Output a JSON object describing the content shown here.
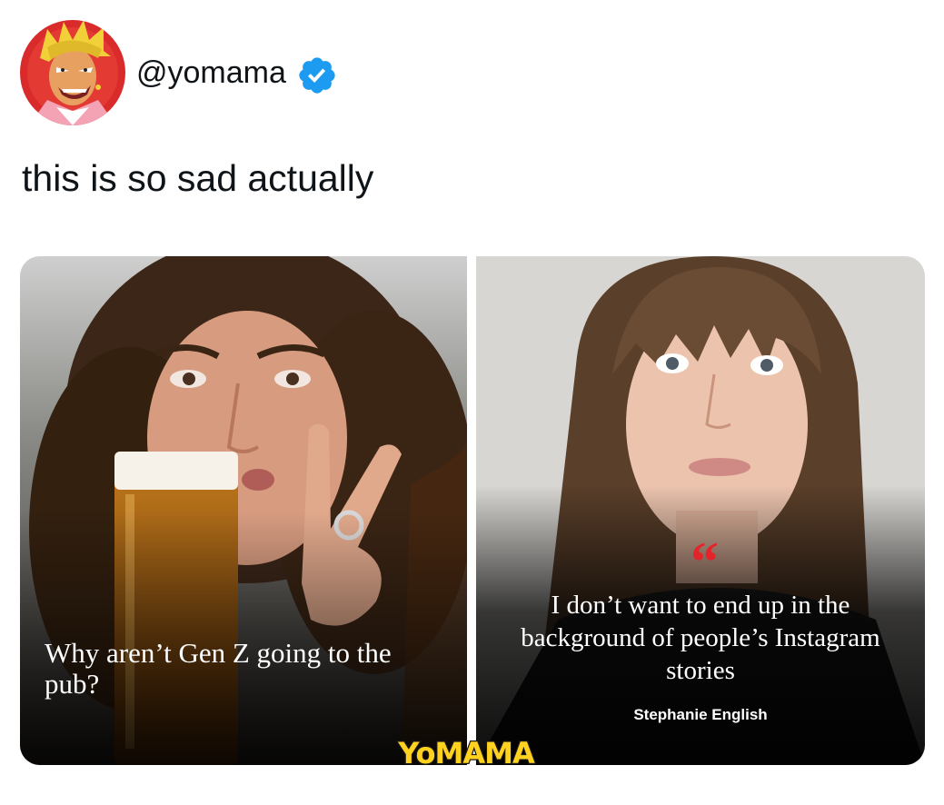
{
  "post": {
    "username": "@yomama",
    "verified": true,
    "text": "this is so sad actually"
  },
  "media": {
    "left": {
      "headline": "Why aren’t Gen Z going to the pub?"
    },
    "right": {
      "quote_mark": "“",
      "quote": "I don’t want to end up in the background of people’s Instagram stories",
      "author": "Stephanie English"
    }
  },
  "watermark": {
    "text": "YoMAMA"
  },
  "colors": {
    "text": "#0f1419",
    "verified_blue": "#1d9bf0",
    "quote_red": "#e3242b",
    "watermark_yellow": "#ffd21f"
  },
  "icons": {
    "verified": "verified-badge-icon"
  }
}
